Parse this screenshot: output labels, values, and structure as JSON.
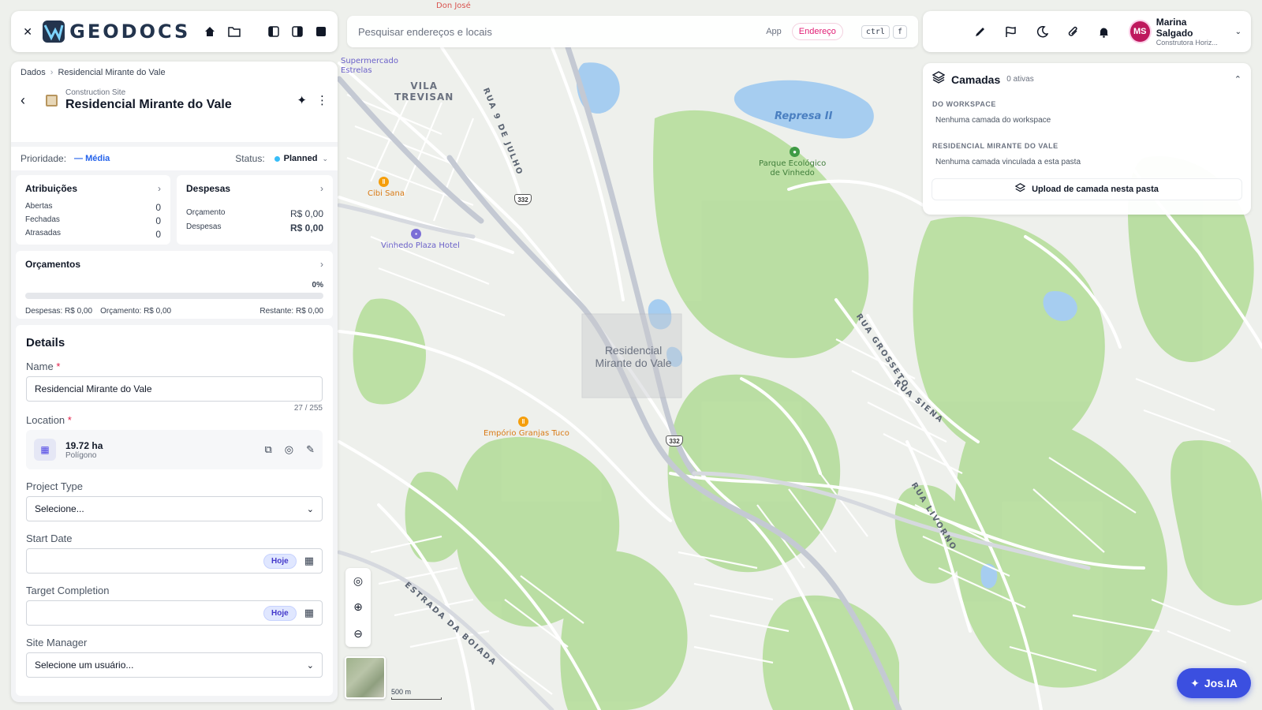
{
  "app": {
    "logo_text": "GEODOCS"
  },
  "search": {
    "placeholder": "Pesquisar endereços e locais",
    "mode_app": "App",
    "mode_address": "Endereço",
    "kbd_ctrl": "ctrl",
    "kbd_key": "f"
  },
  "user": {
    "initials": "MS",
    "name": "Marina Salgado",
    "org": "Construtora Horiz..."
  },
  "breadcrumb": [
    "Dados",
    "Residencial Mirante do Vale"
  ],
  "site": {
    "kind": "Construction Site",
    "name": "Residencial Mirante do Vale"
  },
  "priority": {
    "label": "Prioridade:",
    "value": "— Média"
  },
  "status": {
    "label": "Status:",
    "value": "Planned"
  },
  "atribuicoes": {
    "title": "Atribuições",
    "rows": [
      {
        "label": "Abertas",
        "value": "0"
      },
      {
        "label": "Fechadas",
        "value": "0"
      },
      {
        "label": "Atrasadas",
        "value": "0"
      }
    ]
  },
  "despesas": {
    "title": "Despesas",
    "rows": [
      {
        "label": "Orçamento",
        "value": "R$ 0,00"
      },
      {
        "label": "Despesas",
        "value": "R$ 0,00"
      }
    ]
  },
  "orcamentos": {
    "title": "Orçamentos",
    "percent": "0%",
    "progress": 0,
    "spent": "Despesas: R$ 0,00",
    "budget": "Orçamento: R$ 0,00",
    "remaining": "Restante: R$ 0,00"
  },
  "details": {
    "title": "Details",
    "name_label": "Name",
    "name_value": "Residencial Mirante do Vale",
    "name_counter": "27 / 255",
    "location_label": "Location",
    "location_area": "19.72 ha",
    "location_kind": "Polígono",
    "project_type_label": "Project Type",
    "project_type_value": "Selecione...",
    "start_date_label": "Start Date",
    "target_label": "Target Completion",
    "today": "Hoje",
    "site_manager_label": "Site Manager",
    "site_manager_value": "Selecione um usuário..."
  },
  "layers": {
    "title": "Camadas",
    "count": "0 ativas",
    "workspace_section": "DO WORKSPACE",
    "workspace_empty": "Nenhuma camada do workspace",
    "folder_section": "RESIDENCIAL MIRANTE DO VALE",
    "folder_empty": "Nenhuma camada vinculada a esta pasta",
    "upload": "Upload de camada nesta pasta"
  },
  "map": {
    "labels": {
      "vila_trevisan": "VILA\nTREVISAN",
      "rua_9_julho": "RUA 9 DE JULHO",
      "represa": "Represa II",
      "parque": "Parque Ecológico\nde Vinhedo",
      "cibi": "Cibi Sana",
      "vinhedo_hotel": "Vinhedo Plaza Hotel",
      "site": "Residencial\nMirante do Vale",
      "emporio": "Empório Granjas Tuco",
      "rua_grosseto": "RUA GROSSETO",
      "rua_siena": "RUA SIENA",
      "rua_livorno": "RUA LIVORNO",
      "estrada": "ESTRADA DA BOIADA",
      "supermercado": "Supermercado\nEstrelas",
      "don_jose": "Don José",
      "road_332": "332"
    },
    "scale": "500 m"
  },
  "assistant": {
    "label": "Jos.IA"
  }
}
